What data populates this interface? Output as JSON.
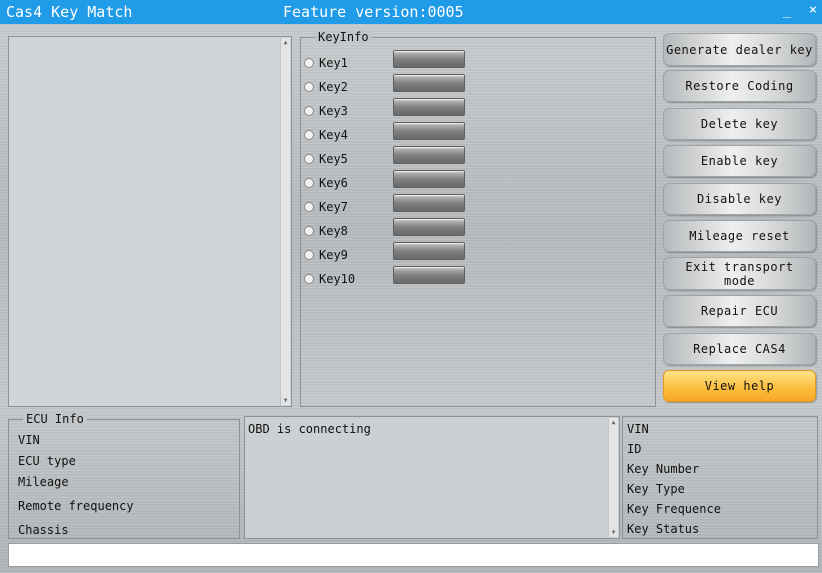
{
  "window": {
    "title": "Cas4 Key Match",
    "feature_version": "Feature version:0005",
    "minimize_glyph": "_",
    "close_glyph": "×"
  },
  "keyinfo": {
    "label": "KeyInfo",
    "keys": [
      "Key1",
      "Key2",
      "Key3",
      "Key4",
      "Key5",
      "Key6",
      "Key7",
      "Key8",
      "Key9",
      "Key10"
    ]
  },
  "actions": {
    "generate_dealer_key": "Generate dealer key",
    "restore_coding": "Restore Coding",
    "delete_key": "Delete key",
    "enable_key": "Enable key",
    "disable_key": "Disable key",
    "mileage_reset": "Mileage reset",
    "exit_transport_mode": "Exit transport mode",
    "repair_ecu": "Repair ECU",
    "replace_cas4": "Replace CAS4",
    "view_help": "View help"
  },
  "ecu_info": {
    "label": "ECU Info",
    "vin": "VIN",
    "ecu_type": "ECU type",
    "mileage": "Mileage",
    "remote_frequency": "Remote frequency",
    "chassis": "Chassis"
  },
  "log": {
    "text": "OBD is connecting"
  },
  "key_detail": {
    "vin": "VIN",
    "id": "ID",
    "key_number": "Key Number",
    "key_type": "Key Type",
    "key_frequence": "Key Frequence",
    "key_status": "Key Status"
  },
  "colors": {
    "titlebar": "#1f9be8",
    "help_button": "#fbbd3a"
  }
}
